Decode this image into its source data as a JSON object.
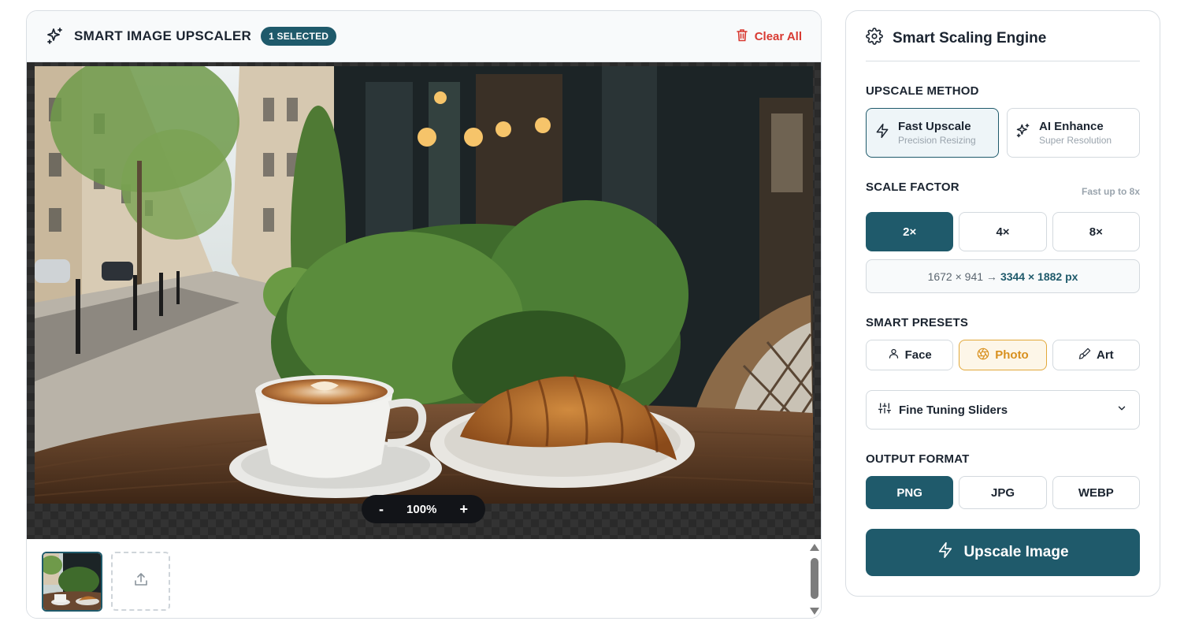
{
  "header": {
    "title": "SMART IMAGE UPSCALER",
    "badge": "1 SELECTED",
    "clear_all": "Clear All",
    "sparkle_icon": "sparkles-icon",
    "trash_icon": "trash-icon"
  },
  "viewer": {
    "zoom_minus": "-",
    "zoom_value": "100%",
    "zoom_plus": "+"
  },
  "engine": {
    "title": "Smart Scaling Engine",
    "icon": "gear-icon"
  },
  "upscale_method": {
    "label": "UPSCALE METHOD",
    "options": [
      {
        "name": "Fast Upscale",
        "sub": "Precision Resizing",
        "icon": "zap-icon",
        "active": true
      },
      {
        "name": "AI Enhance",
        "sub": "Super Resolution",
        "icon": "sparkles-icon",
        "active": false
      }
    ]
  },
  "scale_factor": {
    "label": "SCALE FACTOR",
    "hint": "Fast up to 8x",
    "options": [
      "2×",
      "4×",
      "8×"
    ],
    "selected": "2×",
    "source_dims": "1672 × 941 →",
    "target_dims": "3344 × 1882 px"
  },
  "smart_presets": {
    "label": "SMART PRESETS",
    "options": [
      {
        "name": "Face",
        "icon": "user-icon"
      },
      {
        "name": "Photo",
        "icon": "aperture-icon"
      },
      {
        "name": "Art",
        "icon": "brush-icon"
      }
    ],
    "selected": "Photo"
  },
  "fine_tuning": {
    "label": "Fine Tuning Sliders",
    "icon": "sliders-icon"
  },
  "output_format": {
    "label": "OUTPUT FORMAT",
    "options": [
      "PNG",
      "JPG",
      "WEBP"
    ],
    "selected": "PNG"
  },
  "action": {
    "label": "Upscale Image"
  },
  "colors": {
    "accent": "#1f5a6b",
    "danger": "#d83a32",
    "preset_accent": "#e2a83a"
  }
}
